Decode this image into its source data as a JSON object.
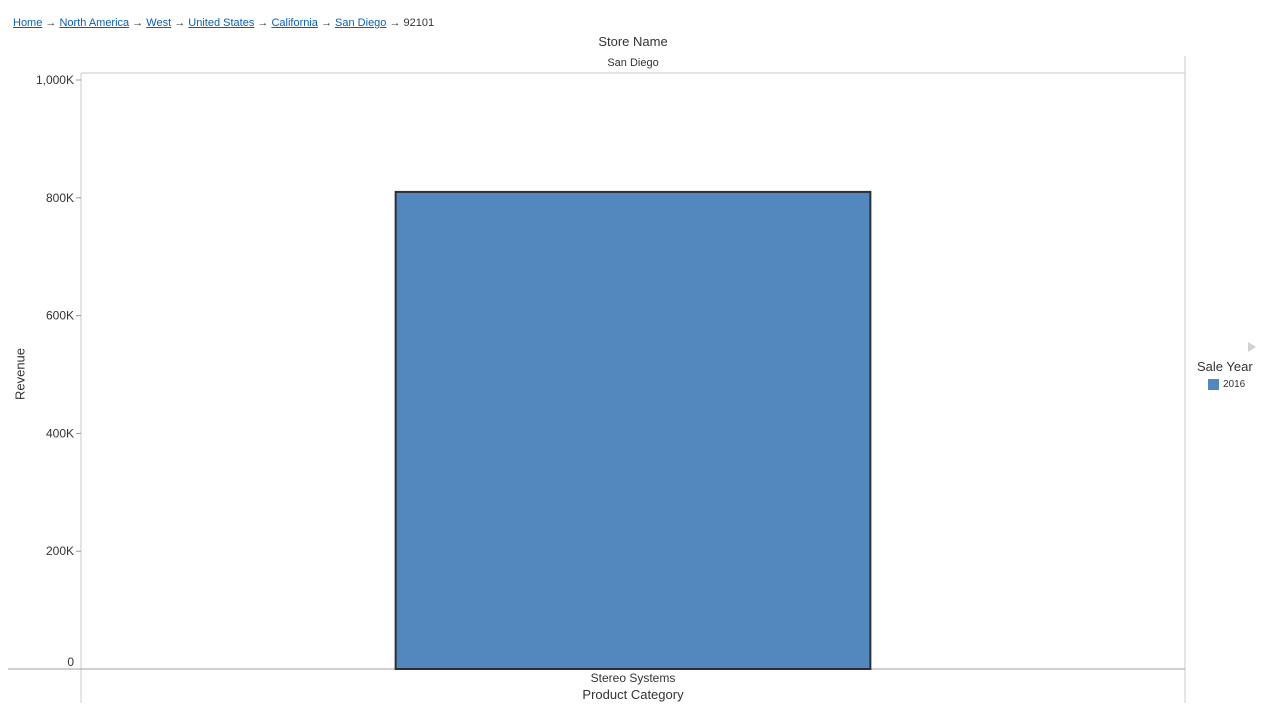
{
  "breadcrumb": {
    "links": [
      "Home",
      "North America",
      "West",
      "United States",
      "California",
      "San Diego"
    ],
    "current": "92101",
    "separator": "→"
  },
  "header": {
    "title": "Store Name",
    "value": "San Diego"
  },
  "legend": {
    "title": "Sale Year",
    "items": [
      {
        "label": "2016",
        "color": "#5288be"
      }
    ]
  },
  "colors": {
    "bar_fill": "#5288be",
    "bar_stroke": "#2b2f36",
    "link": "#0a5fb4"
  },
  "chart_data": {
    "type": "bar",
    "categories": [
      "Stereo Systems"
    ],
    "series": [
      {
        "name": "2016",
        "values": [
          810000
        ]
      }
    ],
    "xlabel": "Product Category",
    "ylabel": "Revenue",
    "ylim": [
      0,
      1000000
    ],
    "yticks": [
      0,
      200000,
      400000,
      600000,
      800000,
      1000000
    ],
    "ytick_labels": [
      "0",
      "200K",
      "400K",
      "600K",
      "800K",
      "1,000K"
    ],
    "grid": false,
    "legend_position": "right"
  }
}
